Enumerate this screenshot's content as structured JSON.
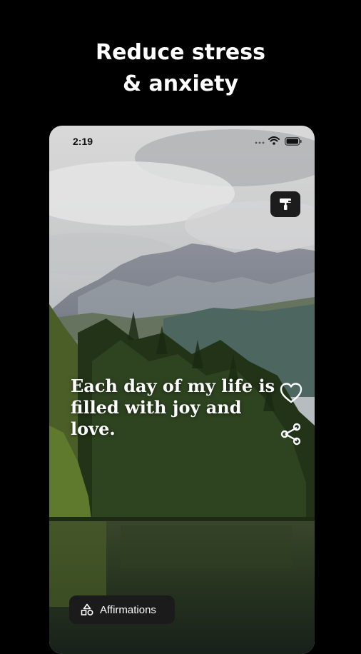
{
  "headline": {
    "line1": "Reduce stress",
    "line2": "& anxiety"
  },
  "status_bar": {
    "time": "2:19",
    "icons": [
      "signal-dots-icon",
      "wifi-icon",
      "battery-icon"
    ]
  },
  "quote": {
    "line1": "Each day of my life is",
    "line2": "filled with joy and",
    "line3": "love."
  },
  "actions": {
    "theme_icon": "paint-roller-icon",
    "like_icon": "heart-icon",
    "share_icon": "share-icon"
  },
  "category_chip": {
    "label": "Affirmations",
    "icon": "shapes-icon"
  },
  "colors": {
    "page_background": "#000000",
    "headline_text": "#ffffff",
    "chip_background": "#1b1b1b"
  }
}
